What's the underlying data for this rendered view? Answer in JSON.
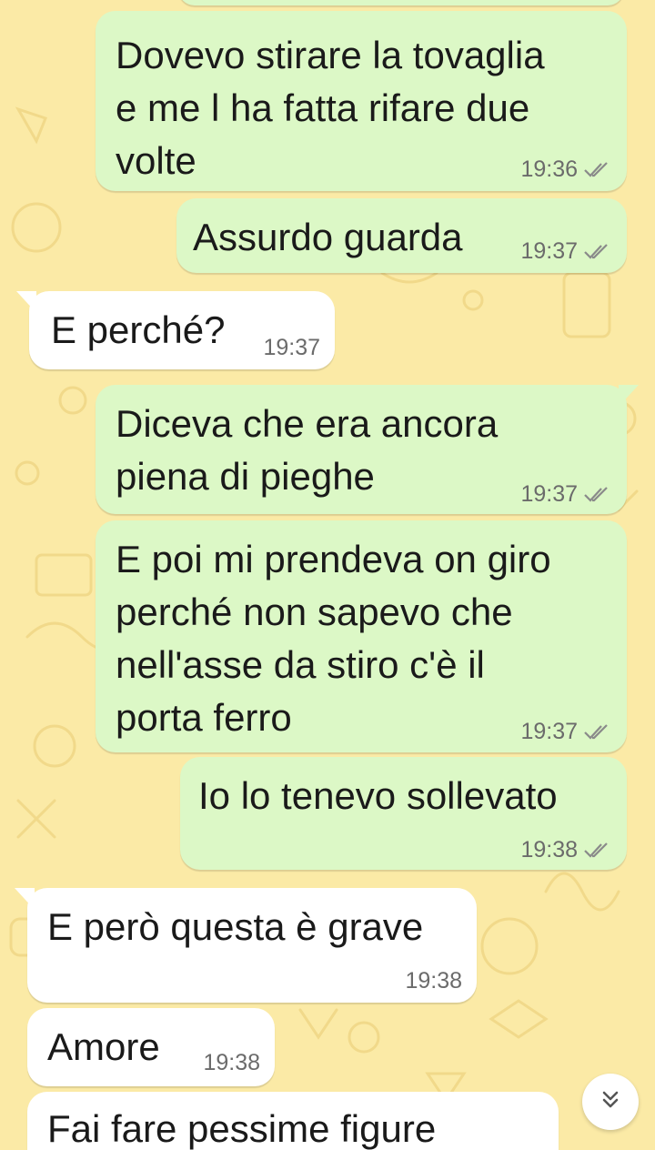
{
  "theme": {
    "wallpaper": "#fbeaa6",
    "outgoing_bubble": "#dcf8c6",
    "incoming_bubble": "#ffffff",
    "tick_color": "#8a8a8a"
  },
  "messages": [
    {
      "direction": "outgoing",
      "text": "Dovevo stirare la tovaglia\ne me l ha fatta rifare due\nvolte",
      "time": "19:36",
      "status": "delivered-icon"
    },
    {
      "direction": "outgoing",
      "text": "Assurdo guarda",
      "time": "19:37",
      "status": "delivered-icon"
    },
    {
      "direction": "incoming",
      "text": "E perché?",
      "time": "19:37"
    },
    {
      "direction": "outgoing",
      "text": "Diceva che era ancora\npiena di pieghe",
      "time": "19:37",
      "status": "delivered-icon"
    },
    {
      "direction": "outgoing",
      "text": "E poi mi prendeva on giro\nperché non sapevo che\nnell'asse da stiro c'è il\nporta ferro",
      "time": "19:37",
      "status": "delivered-icon"
    },
    {
      "direction": "outgoing",
      "text": "Io lo tenevo sollevato",
      "time": "19:38",
      "status": "delivered-icon"
    },
    {
      "direction": "incoming",
      "text": "E però questa è grave",
      "time": "19:38"
    },
    {
      "direction": "incoming",
      "text": "Amore",
      "time": "19:38"
    },
    {
      "direction": "incoming",
      "text": "Fai fare pessime figure",
      "time": ""
    }
  ],
  "scroll_button": {
    "icon": "chevron-double-down-icon"
  }
}
